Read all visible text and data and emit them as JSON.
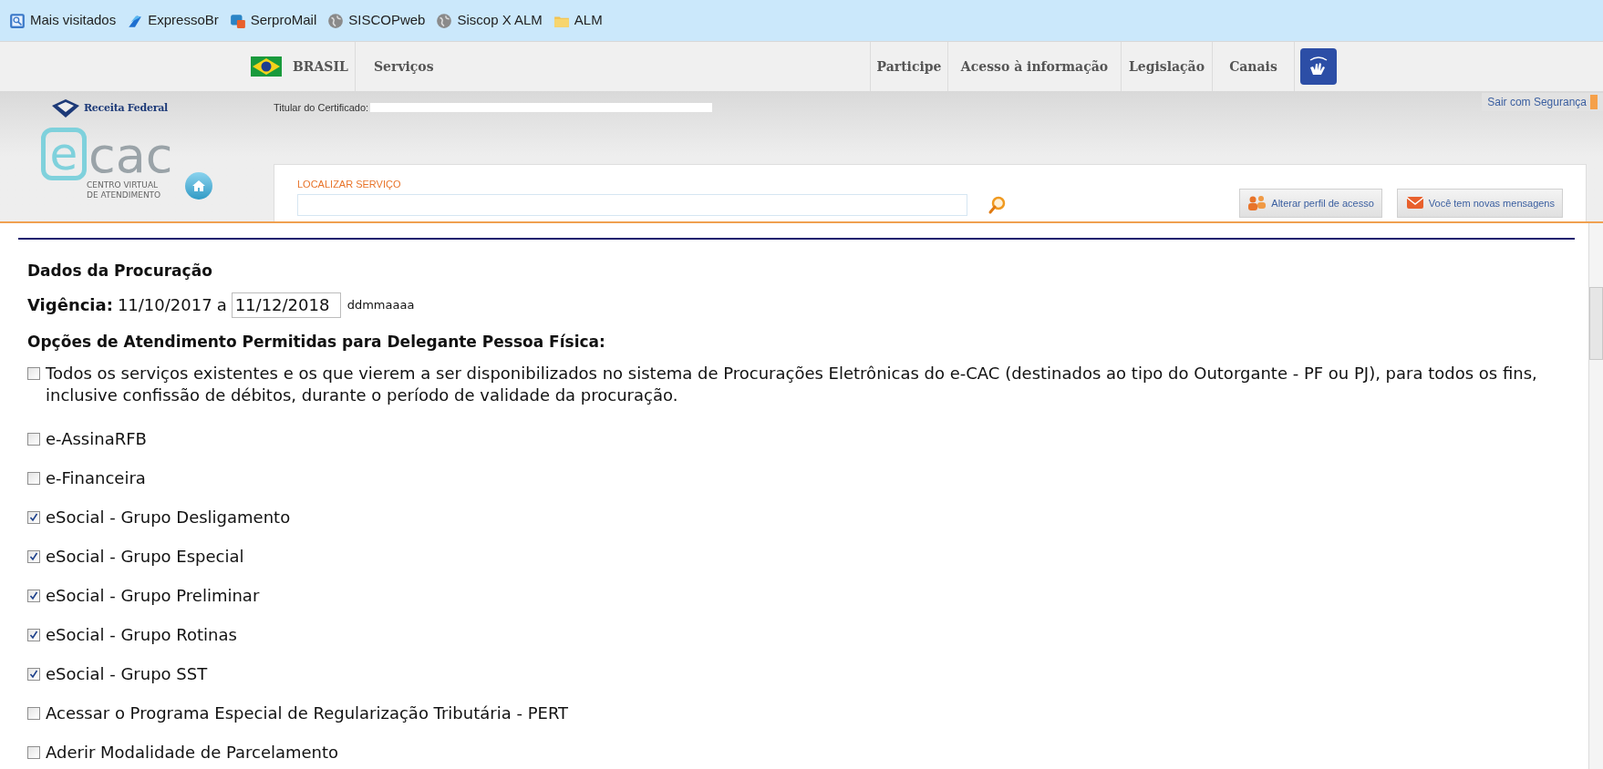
{
  "bookmarks": [
    {
      "label": "Mais visitados",
      "kind": "page"
    },
    {
      "label": "ExpressoBr",
      "kind": "app"
    },
    {
      "label": "SerproMail",
      "kind": "mail"
    },
    {
      "label": "SISCOPweb",
      "kind": "globe"
    },
    {
      "label": "Siscop X ALM",
      "kind": "globe"
    },
    {
      "label": "ALM",
      "kind": "folder"
    }
  ],
  "gov_bar": {
    "country": "BRASIL",
    "items": [
      "Serviços",
      "Participe",
      "Acesso à informação",
      "Legislação",
      "Canais"
    ]
  },
  "header": {
    "agency": "Receita Federal",
    "certificate_label": "Titular do Certificado:",
    "logout": "Sair com Segurança",
    "logo": {
      "mark": "e",
      "name": "cac",
      "line_1": "CENTRO VIRTUAL",
      "line_2": "DE ATENDIMENTO"
    },
    "search": {
      "label": "LOCALIZAR SERVIÇO"
    },
    "buttons": [
      {
        "label": "Alterar perfil de acesso",
        "kind": "profile"
      },
      {
        "label": "Você tem novas mensagens",
        "kind": "message"
      }
    ]
  },
  "form": {
    "title": "Dados da Procuração",
    "validity": {
      "label": "Vigência:",
      "start": "11/10/2017",
      "separator": "a",
      "end_value": "11/12/2018",
      "format_hint": "ddmmaaaa"
    },
    "options_title": "Opções de Atendimento Permitidas para Delegante Pessoa Física:",
    "options": [
      {
        "label": "Todos os serviços existentes e os que vierem a ser disponibilizados no sistema de Procurações Eletrônicas do e-CAC (destinados ao tipo do Outorgante - PF ou PJ), para todos os fins, inclusive confissão de débitos, durante o período de validade da procuração.",
        "checked": false
      },
      {
        "label": "e-AssinaRFB",
        "checked": false
      },
      {
        "label": "e-Financeira",
        "checked": false
      },
      {
        "label": "eSocial - Grupo Desligamento",
        "checked": true
      },
      {
        "label": "eSocial - Grupo Especial",
        "checked": true
      },
      {
        "label": "eSocial - Grupo Preliminar",
        "checked": true
      },
      {
        "label": "eSocial - Grupo Rotinas",
        "checked": true
      },
      {
        "label": "eSocial - Grupo SST",
        "checked": true
      },
      {
        "label": "Acessar o Programa Especial de Regularização Tributária - PERT",
        "checked": false
      },
      {
        "label": "Aderir Modalidade de Parcelamento",
        "checked": false
      }
    ]
  }
}
